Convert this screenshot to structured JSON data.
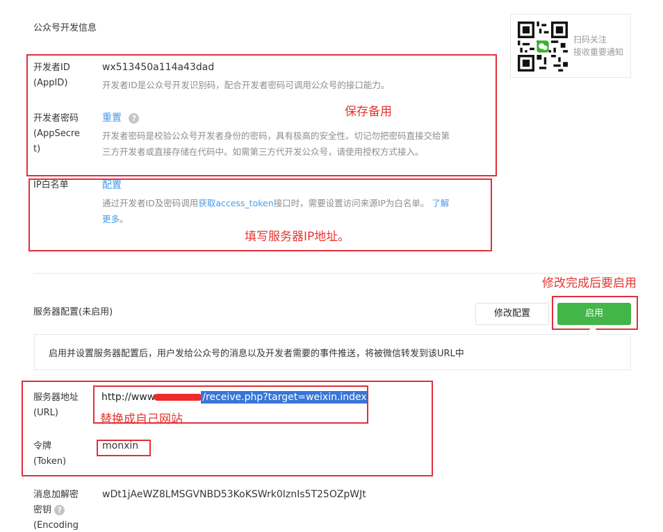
{
  "section_title": "公众号开发信息",
  "qr": {
    "line1": "扫码关注",
    "line2": "接收重要通知"
  },
  "app_id": {
    "label_line1": "开发者ID",
    "label_line2": "(AppID)",
    "value": "wx513450a114a43dad",
    "tip": "开发者ID是公众号开发识别码，配合开发者密码可调用公众号的接口能力。"
  },
  "app_secret": {
    "label_line1": "开发者密码",
    "label_line2": "(AppSecre",
    "label_line3": "t)",
    "reset_link": "重置",
    "help": "?",
    "tip_line1": "开发者密码是校验公众号开发者身份的密码，具有极高的安全性。切记勿把密码直接交给第",
    "tip_line2": "三方开发者或直接存储在代码中。如需第三方代开发公众号，请使用授权方式接入。"
  },
  "ip_whitelist": {
    "label": "IP白名单",
    "config_link": "配置",
    "tip_pre": "通过开发者ID及密码调用",
    "tip_link": "获取access_token",
    "tip_mid": "接口时，需要设置访问来源IP为白名单。",
    "learn_more_1": "了解",
    "learn_more_2": "更多",
    "tip_end": "。"
  },
  "server_config": {
    "title": "服务器配置(未启用)",
    "modify_button": "修改配置",
    "enable_button": "启用",
    "info": "启用并设置服务器配置后，用户发给公众号的消息以及开发者需要的事件推送，将被微信转发到该URL中"
  },
  "server_url": {
    "label_line1": "服务器地址",
    "label_line2": "(URL)",
    "value_prefix": "http://www",
    "value_suffix": "/receive.php?target=weixin.index"
  },
  "token": {
    "label_line1": "令牌",
    "label_line2": "(Token)",
    "value": "monxin"
  },
  "encoding_key": {
    "label_line1": "消息加解密",
    "label_line2": "密钥",
    "label_line3": "(Encoding",
    "help": "?",
    "value": "wDt1jAeWZ8LMSGVNBD53KoKSWrk0IznIs5T25OZpWJt"
  },
  "annotations": {
    "save_backup": "保存备用",
    "fill_ip": "填写服务器IP地址。",
    "enable_after": "修改完成后要启用",
    "replace_site": "替换成自己网站"
  },
  "colors": {
    "annotation_red": "#e02f3a",
    "link_blue": "#459ae9",
    "primary_green": "#44b549"
  }
}
